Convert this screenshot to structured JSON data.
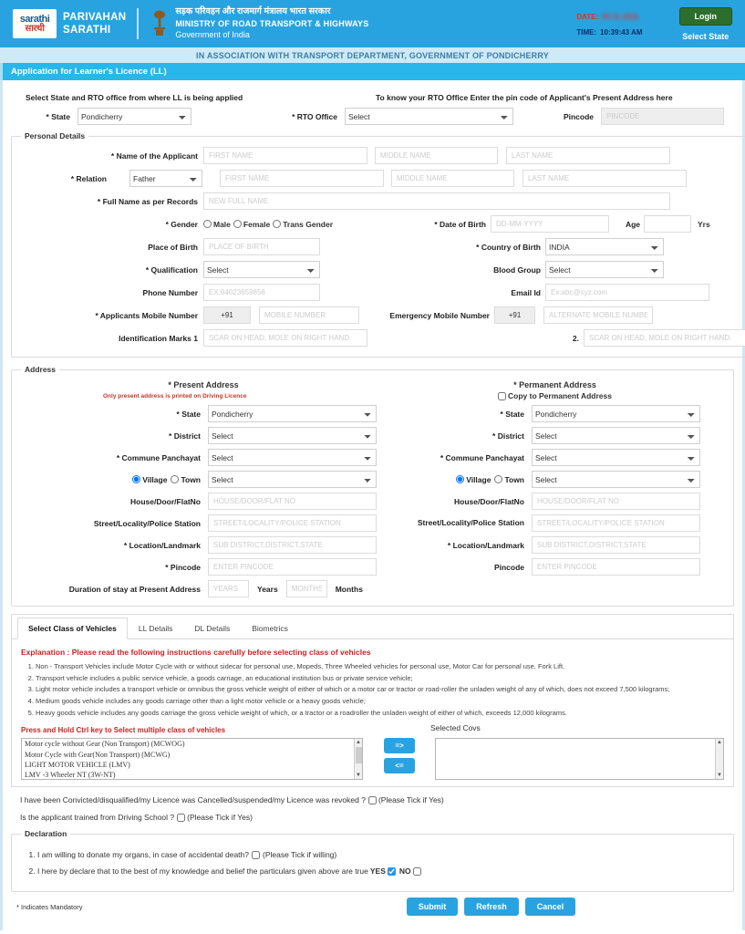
{
  "header": {
    "logo_line1": "sarathi",
    "logo_line2": "सारथी",
    "brand_line1": "PARIVAHAN",
    "brand_line2": "SARATHI",
    "ministry_hindi": "सड़क परिवहन और राजमार्ग मंत्रालय भारत सरकार",
    "ministry_english": "MINISTRY OF ROAD TRANSPORT & HIGHWAYS",
    "ministry_gov": "Government of India",
    "date_label": "DATE:",
    "date_value": "05-11-2021",
    "time_label": "TIME:",
    "time_value": "10:39:43 AM",
    "login_label": "Login",
    "select_state_label": "Select State"
  },
  "association_banner": "IN ASSOCIATION WITH TRANSPORT DEPARTMENT, GOVERNMENT OF PONDICHERRY",
  "page_title": "Application for Learner's Licence (LL)",
  "top": {
    "intro_left": "Select State and RTO office from where LL is being applied",
    "intro_right": "To know your RTO Office Enter the pin code of Applicant's Present Address here",
    "state_label": "* State",
    "state_value": "Pondicherry",
    "rto_label": "* RTO Office",
    "rto_value": "Select",
    "pincode_label": "Pincode",
    "pincode_placeholder": "PINCODE"
  },
  "personal": {
    "legend": "Personal Details",
    "name_label": "* Name of the Applicant",
    "first_name_placeholder": "FIRST NAME",
    "middle_name_placeholder": "MIDDLE NAME",
    "last_name_placeholder": "LAST NAME",
    "relation_label": "* Relation",
    "relation_value": "Father",
    "rel_first_placeholder": "FIRST NAME",
    "rel_middle_placeholder": "MIDDLE NAME",
    "rel_last_placeholder": "LAST NAME",
    "fullname_label": "* Full Name as per Records",
    "fullname_placeholder": "NEW FULL NAME",
    "gender_label": "* Gender",
    "gender_options": [
      "Male",
      "Female",
      "Trans Gender"
    ],
    "dob_label": "* Date of Birth",
    "dob_placeholder": "DD-MM-YYYY",
    "age_label": "Age",
    "age_value": "",
    "yrs_label": "Yrs",
    "pob_label": "Place of Birth",
    "pob_placeholder": "PLACE OF BIRTH",
    "country_label": "* Country of Birth",
    "country_value": "INDIA",
    "qualification_label": "* Qualification",
    "qualification_value": "Select",
    "blood_label": "Blood Group",
    "blood_value": "Select",
    "phone_label": "Phone Number",
    "phone_placeholder": "EX:04023659856",
    "email_label": "Email Id",
    "email_placeholder": "Ex:abc@xyz.com",
    "mobile_label": "* Applicants Mobile Number",
    "mobile_code": "+91",
    "mobile_placeholder": "MOBILE NUMBER",
    "emergency_label": "Emergency Mobile Number",
    "emergency_code": "+91",
    "emergency_placeholder": "ALTERNATE MOBILE NUMBER",
    "idmark1_label": "Identification Marks 1",
    "idmark1_placeholder": "SCAR ON HEAD, MOLE ON RIGHT HAND.",
    "idmark2_label": "2.",
    "idmark2_placeholder": "SCAR ON HEAD, MOLE ON RIGHT HAND."
  },
  "address": {
    "legend": "Address",
    "present_title": "* Present Address",
    "permanent_title": "* Permanent Address",
    "present_note": "Only present address is printed on Driving Licence",
    "copy_label": "Copy to Permanent Address",
    "present": {
      "state_label": "* State",
      "state_value": "Pondicherry",
      "district_label": "* District",
      "district_value": "Select",
      "commune_label": "* Commune Panchayat",
      "commune_value": "Select",
      "village_label": "Village",
      "town_label": "Town",
      "village_value": "Select",
      "house_label": "House/Door/FlatNo",
      "house_placeholder": "HOUSE/DOOR/FLAT NO",
      "street_label": "Street/Locality/Police Station",
      "street_placeholder": "STREET/LOCALITY/POLICE STATION",
      "location_label": "* Location/Landmark",
      "location_placeholder": "SUB DISTRICT,DISTRICT,STATE",
      "pincode_label": "* Pincode",
      "pincode_placeholder": "ENTER PINCODE",
      "duration_label": "Duration of stay at Present Address",
      "years_placeholder": "YEARS",
      "years_text": "Years",
      "months_placeholder": "MONTHS",
      "months_text": "Months"
    },
    "permanent": {
      "state_label": "* State",
      "state_value": "Pondicherry",
      "district_label": "* District",
      "district_value": "Select",
      "commune_label": "* Commune Panchayat",
      "commune_value": "Select",
      "village_label": "Village",
      "town_label": "Town",
      "village_value": "Select",
      "house_label": "House/Door/FlatNo",
      "house_placeholder": "HOUSE/DOOR/FLAT NO",
      "street_label": "Street/Locality/Police Station",
      "street_placeholder": "STREET/LOCALITY/POLICE STATION",
      "location_label": "* Location/Landmark",
      "location_placeholder": "SUB DISTRICT,DISTRICT,STATE",
      "pincode_label": "Pincode",
      "pincode_placeholder": "ENTER PINCODE"
    }
  },
  "tabs": [
    {
      "label": "Select Class of Vehicles",
      "active": true
    },
    {
      "label": "LL Details",
      "active": false
    },
    {
      "label": "DL Details",
      "active": false
    },
    {
      "label": "Biometrics",
      "active": false
    }
  ],
  "vehicles": {
    "explanation_title": "Explanation : Please read the following instructions carefully before selecting class of vehicles",
    "instructions": [
      "Non - Transport Vehicles include Motor Cycle with or without sidecar for personal use, Mopeds, Three Wheeled vehicles for personal use, Motor Car for personal use, Fork Lift.",
      "Transport vehicle includes a public service vehicle, a goods carriage, an educational institution bus or private service vehicle;",
      "Light motor vehicle includes a transport vehicle or omnibus the gross vehicle weight of either of which or a motor car or tractor or road-roller the unladen weight of any of which, does not exceed 7,500 kilograms;",
      "Medium goods vehicle includes any goods carriage other than a light motor vehicle or a heavy goods vehicle;",
      "Heavy goods vehicle includes any goods carriage the gross vehicle weight of which, or a tractor or a roadroller the unladen weight of either of which, exceeds 12,000 kilograms."
    ],
    "press_hold": "Press and Hold Ctrl key to Select multiple class of vehicles",
    "available": [
      "Motor cycle without Gear (Non Transport) (MCWOG)",
      "Motor Cycle with Gear(Non Transport) (MCWG)",
      "LIGHT MOTOR VEHICLE (LMV)",
      "LMV -3 Wheeler NT (3W-NT)"
    ],
    "add_button": "=>",
    "remove_button": "<=",
    "selected_label": "Selected Covs",
    "selected": []
  },
  "questions": {
    "q1": "I have been Convicted/disqualified/my Licence was Cancelled/suspended/my Licence was revoked ?",
    "q1_hint": "(Please Tick if Yes)",
    "q2": "Is the applicant trained from Driving School ?",
    "q2_hint": "(Please Tick if Yes)"
  },
  "declaration": {
    "legend": "Declaration",
    "item1": "I am willing to donate my organs, in case of accidental death?",
    "item1_hint": "(Please Tick if willing)",
    "item2": "I here by declare that to the best of my knowledge and belief the particulars given above are true",
    "yes_label": "YES",
    "no_label": "NO",
    "yes_checked": true,
    "no_checked": false
  },
  "footer": {
    "mandatory_note": "* Indicates Mandatory",
    "submit_label": "Submit",
    "refresh_label": "Refresh",
    "cancel_label": "Cancel"
  },
  "colors": {
    "header_blue": "#29a3e0",
    "banner_light": "#cfe9f7",
    "title_blue": "#29b6ea",
    "login_green": "#2c6e2e",
    "red_text": "#cc2222",
    "date_red": "#d9342b"
  }
}
